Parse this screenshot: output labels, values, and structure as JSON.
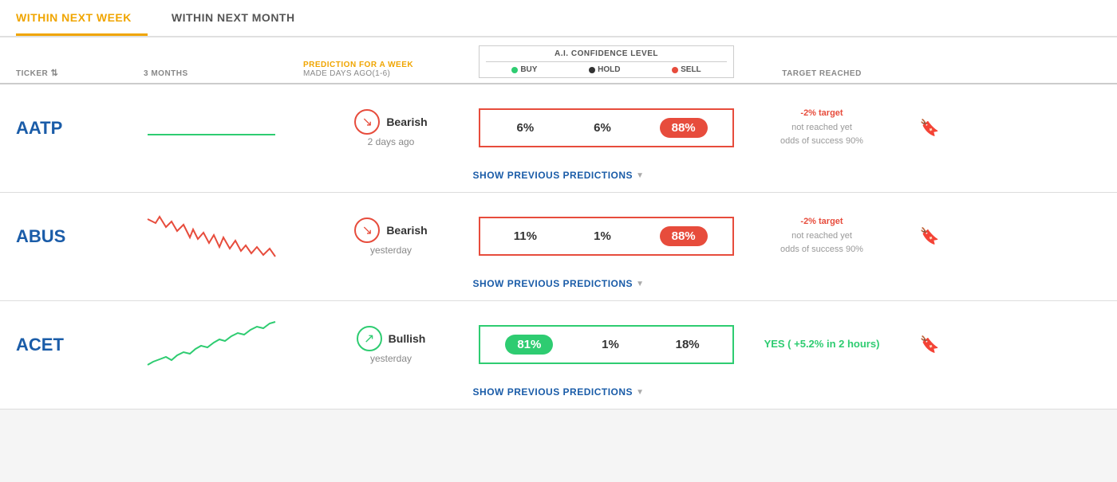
{
  "tabs": [
    {
      "id": "week",
      "label": "WITHIN NEXT WEEK",
      "active": true
    },
    {
      "id": "month",
      "label": "WITHIN NEXT MONTH",
      "active": false
    }
  ],
  "columns": {
    "ticker": "TICKER",
    "months3": "3 MONTHS",
    "prediction": "PREDICTION FOR A WEEK",
    "predictionSub": "MADE DAYS AGO(1-6)",
    "aiConfidence": "A.I. CONFIDENCE LEVEL",
    "buyLabel": "BUY",
    "holdLabel": "HOLD",
    "sellLabel": "SELL",
    "targetReached": "TARGET REACHED"
  },
  "stocks": [
    {
      "ticker": "AATP",
      "signal": "Bearish",
      "signalType": "bearish",
      "timeAgo": "2 days ago",
      "buy": "6%",
      "hold": "6%",
      "sell": "88%",
      "sellHighlight": true,
      "buyHighlight": false,
      "targetText": "-2% target",
      "targetSub": "not reached yet",
      "targetOdds": "odds of success 90%",
      "targetYes": null,
      "chartColor": "#2ecc71",
      "chartPoints": "10,50 50,50 90,50 130,50 170,50",
      "chartType": "flat"
    },
    {
      "ticker": "ABUS",
      "signal": "Bearish",
      "signalType": "bearish",
      "timeAgo": "yesterday",
      "buy": "11%",
      "hold": "1%",
      "sell": "88%",
      "sellHighlight": true,
      "buyHighlight": false,
      "targetText": "-2% target",
      "targetSub": "not reached yet",
      "targetOdds": "odds of success 90%",
      "targetYes": null,
      "chartColor": "#e74c3c",
      "chartType": "zigzag"
    },
    {
      "ticker": "ACET",
      "signal": "Bullish",
      "signalType": "bullish",
      "timeAgo": "yesterday",
      "buy": "81%",
      "hold": "1%",
      "sell": "18%",
      "sellHighlight": false,
      "buyHighlight": true,
      "targetText": null,
      "targetSub": null,
      "targetOdds": null,
      "targetYes": "YES ( +5.2% in 2 hours)",
      "chartColor": "#2ecc71",
      "chartType": "uptrend"
    }
  ],
  "showPreviousLabel": "SHOW PREVIOUS PREDICTIONS"
}
